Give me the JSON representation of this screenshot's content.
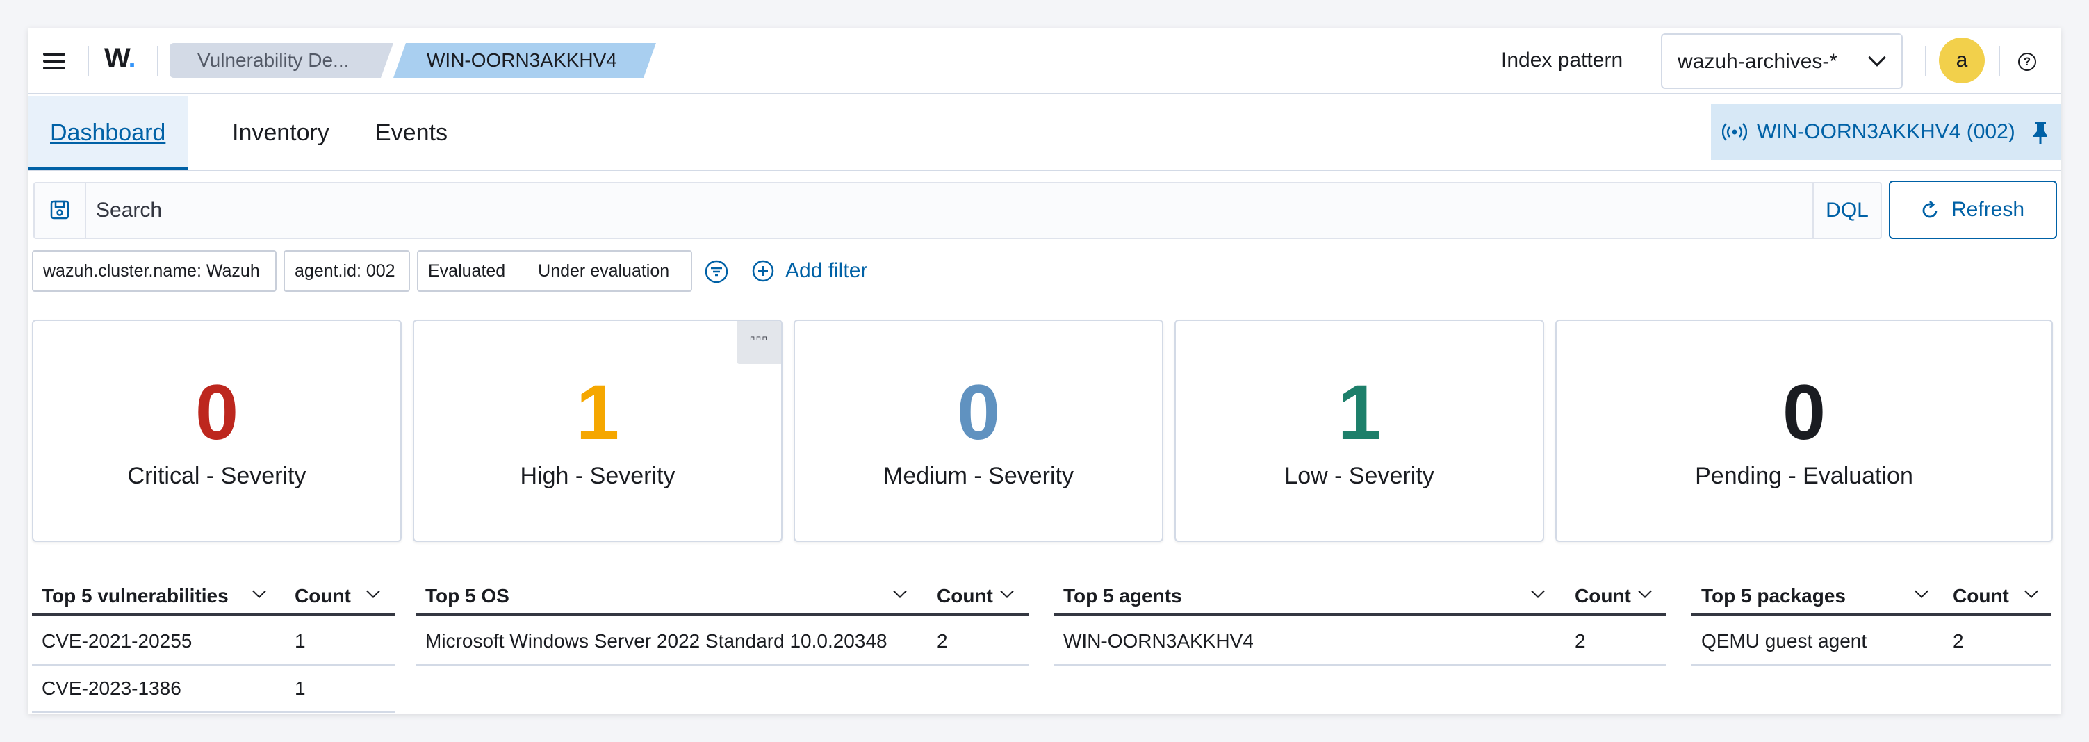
{
  "header": {
    "logo": "W",
    "breadcrumbs": [
      "Vulnerability De...",
      "WIN-OORN3AKKHV4"
    ],
    "index_pattern_label": "Index pattern",
    "index_pattern_value": "wazuh-archives-*",
    "avatar_initial": "a",
    "help_glyph": "?"
  },
  "tabs": {
    "items": [
      "Dashboard",
      "Inventory",
      "Events"
    ],
    "active": "Dashboard",
    "agent_pill": "WIN-OORN3AKKHV4 (002)"
  },
  "search": {
    "placeholder": "Search",
    "language": "DQL",
    "refresh_label": "Refresh"
  },
  "filters": {
    "pills": [
      "wazuh.cluster.name: Wazuh",
      "agent.id: 002"
    ],
    "status_pill": [
      "Evaluated",
      "Under evaluation"
    ],
    "add_filter_label": "Add filter"
  },
  "metrics": [
    {
      "value": "0",
      "label": "Critical - Severity",
      "color": "#bd271e"
    },
    {
      "value": "1",
      "label": "High - Severity",
      "color": "#f5a700"
    },
    {
      "value": "0",
      "label": "Medium - Severity",
      "color": "#6092c0"
    },
    {
      "value": "1",
      "label": "Low - Severity",
      "color": "#1d7f6a"
    },
    {
      "value": "0",
      "label": "Pending - Evaluation",
      "color": "#1a1c21"
    }
  ],
  "metric_menu_glyph": "▫▫▫",
  "tables": {
    "vulnerabilities": {
      "headers": [
        "Top 5 vulnerabilities",
        "Count"
      ],
      "rows": [
        [
          "CVE-2021-20255",
          "1"
        ],
        [
          "CVE-2023-1386",
          "1"
        ]
      ]
    },
    "os": {
      "headers": [
        "Top 5 OS",
        "Count"
      ],
      "rows": [
        [
          "Microsoft Windows Server 2022 Standard 10.0.20348",
          "2"
        ]
      ]
    },
    "agents": {
      "headers": [
        "Top 5 agents",
        "Count"
      ],
      "rows": [
        [
          "WIN-OORN3AKKHV4",
          "2"
        ]
      ]
    },
    "packages": {
      "headers": [
        "Top 5 packages",
        "Count"
      ],
      "rows": [
        [
          "QEMU guest agent",
          "2"
        ]
      ]
    }
  }
}
